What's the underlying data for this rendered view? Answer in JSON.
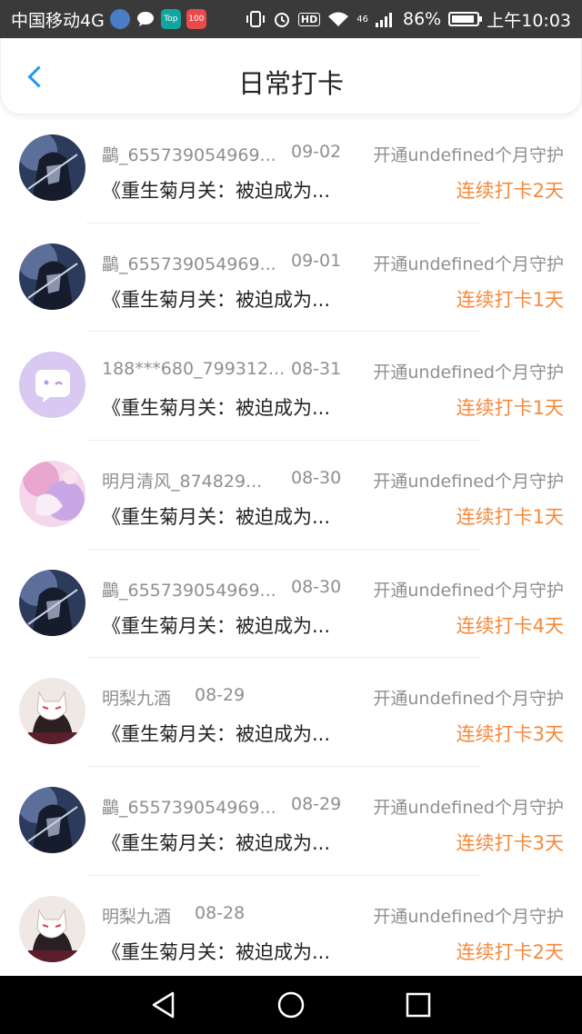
{
  "status_bar": {
    "carrier": "中国移动4G",
    "battery": "86%",
    "time": "上午10:03",
    "network": "46",
    "hd": "HD",
    "apps": [
      {
        "icon": "browser-icon",
        "color": "#4a7cc7",
        "label": ""
      },
      {
        "icon": "chat-icon",
        "color": "#3a3a3a",
        "label": ""
      },
      {
        "icon": "top-app-icon",
        "color": "#12a5a0",
        "label": "Top"
      },
      {
        "icon": "score-app-icon",
        "color": "#e94b4b",
        "label": "100"
      }
    ]
  },
  "header": {
    "title": "日常打卡",
    "back_icon": "chevron-left-icon",
    "accent_color": "#1e9af0"
  },
  "rows": [
    {
      "name": "鸓_655739054969...",
      "date": "09-02",
      "guard": "开通undefined个月守护",
      "book": "《重生菊月关：被迫成为...",
      "streak": "连续打卡2天",
      "avatar": "dark-anime-avatar"
    },
    {
      "name": "鸓_655739054969...",
      "date": "09-01",
      "guard": "开通undefined个月守护",
      "book": "《重生菊月关：被迫成为...",
      "streak": "连续打卡1天",
      "avatar": "dark-anime-avatar"
    },
    {
      "name": "188***680_799312...",
      "date": "08-31",
      "guard": "开通undefined个月守护",
      "book": "《重生菊月关：被迫成为...",
      "streak": "连续打卡1天",
      "avatar": "chat-bubble-avatar"
    },
    {
      "name": "明月清风_874829...",
      "date": "08-30",
      "guard": "开通undefined个月守护",
      "book": "《重生菊月关：被迫成为...",
      "streak": "连续打卡1天",
      "avatar": "pink-anime-avatar"
    },
    {
      "name": "鸓_655739054969...",
      "date": "08-30",
      "guard": "开通undefined个月守护",
      "book": "《重生菊月关：被迫成为...",
      "streak": "连续打卡4天",
      "avatar": "dark-anime-avatar"
    },
    {
      "name": "明梨九酒",
      "date": "08-29",
      "guard": "开通undefined个月守护",
      "book": "《重生菊月关：被迫成为...",
      "streak": "连续打卡3天",
      "avatar": "fox-mask-avatar"
    },
    {
      "name": "鸓_655739054969...",
      "date": "08-29",
      "guard": "开通undefined个月守护",
      "book": "《重生菊月关：被迫成为...",
      "streak": "连续打卡3天",
      "avatar": "dark-anime-avatar"
    },
    {
      "name": "明梨九酒",
      "date": "08-28",
      "guard": "开通undefined个月守护",
      "book": "《重生菊月关：被迫成为...",
      "streak": "连续打卡2天",
      "avatar": "fox-mask-avatar"
    }
  ],
  "colors": {
    "streak": "#f58a3c",
    "meta": "#8f8f8f"
  },
  "nav_bar": {
    "back_icon": "triangle-back-icon",
    "home_icon": "circle-home-icon",
    "recents_icon": "square-recents-icon"
  }
}
